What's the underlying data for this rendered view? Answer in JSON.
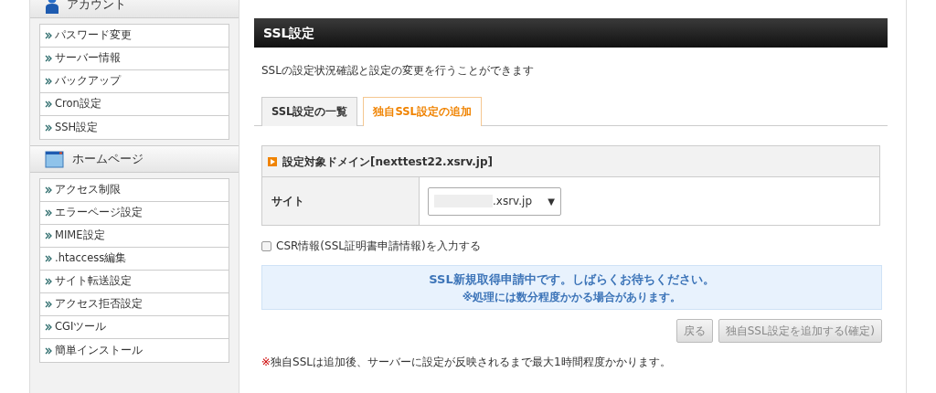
{
  "sidebar": {
    "sections": [
      {
        "title": "アカウント",
        "kind": "person",
        "items": [
          "パスワード変更",
          "サーバー情報",
          "バックアップ",
          "Cron設定",
          "SSH設定"
        ]
      },
      {
        "title": "ホームページ",
        "kind": "window",
        "items": [
          "アクセス制限",
          "エラーページ設定",
          "MIME設定",
          ".htaccess編集",
          "サイト転送設定",
          "アクセス拒否設定",
          "CGIツール",
          "簡単インストール"
        ]
      }
    ]
  },
  "main": {
    "title": "SSL設定",
    "description": "SSLの設定状況確認と設定の変更を行うことができます",
    "tabs": [
      {
        "label": "SSL設定の一覧",
        "selected": false
      },
      {
        "label": "独自SSL設定の追加",
        "selected": true
      }
    ],
    "domain_panel": {
      "heading": "設定対象ドメイン[nexttest22.xsrv.jp]",
      "rows": [
        {
          "label": "サイト",
          "select_value": ".xsrv.jp",
          "caret": "▼"
        }
      ]
    },
    "csr_checkbox": {
      "label": "CSR情報(SSL証明書申請情報)を入力する",
      "checked": false
    },
    "notice": {
      "message": "SSL新規取得申請中です。しばらくお待ちください。",
      "sub_message": "※処理には数分程度かかる場合があります。"
    },
    "buttons": [
      {
        "label": "戻る",
        "disabled": true
      },
      {
        "label": "独自SSL設定を追加する(確定)",
        "disabled": true
      }
    ],
    "footnote": "※独自SSLは追加後、サーバーに設定が反映されるまで最大1時間程度かかります。"
  }
}
